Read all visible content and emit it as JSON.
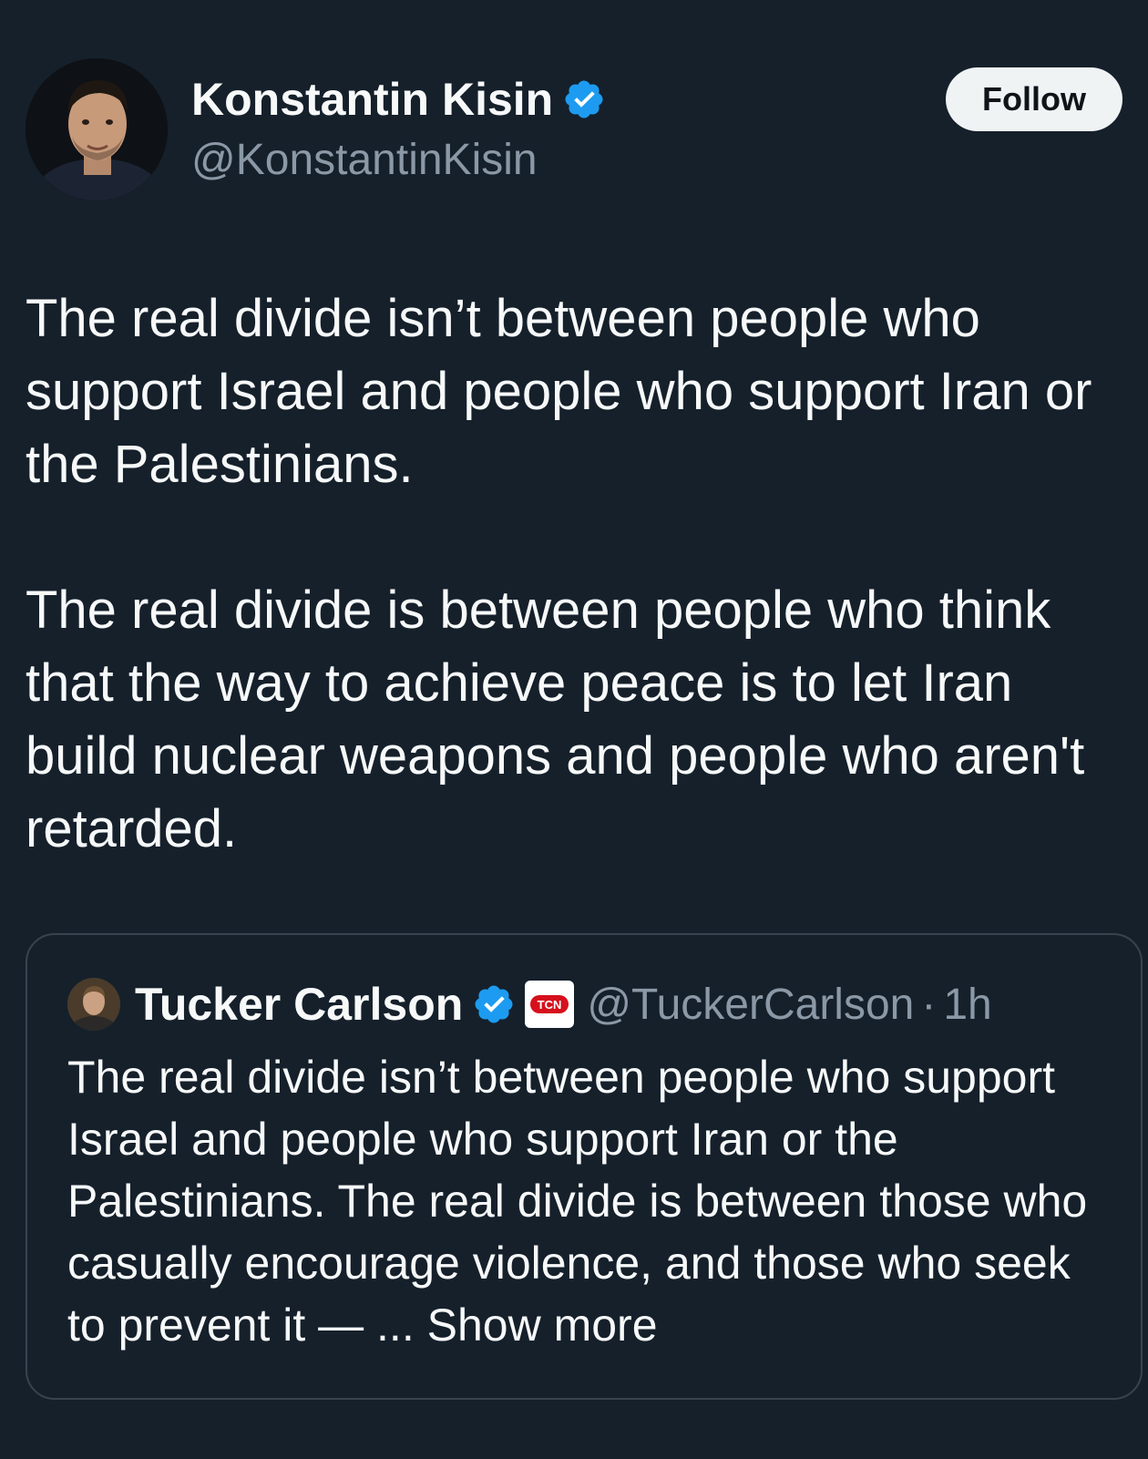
{
  "author": {
    "name": "Konstantin Kisin",
    "handle": "@KonstantinKisin",
    "verified": true
  },
  "follow_button": {
    "label": "Follow"
  },
  "tweet": {
    "paragraphs": [
      "The real divide isn’t between people who support Israel and people who support Iran or the Palestinians.",
      "The real divide is between people who think that the way to achieve peace is to let Iran build nuclear weapons and people who aren't retarded."
    ]
  },
  "quoted_tweet": {
    "name": "Tucker Carlson",
    "handle": "@TuckerCarlson",
    "separator": "·",
    "time": "1h",
    "affiliate_badge": "TCN",
    "text": "The real divide isn’t between people who support Israel and people who support Iran or the Palestinians. The real divide is between those who casually encourage violence, and those who seek to prevent it — ...",
    "show_more_label": "Show more"
  },
  "colors": {
    "background": "#15202b",
    "text": "#f7f9f9",
    "secondary_text": "#8b98a5",
    "verified_badge": "#1d9bf0",
    "border": "#38444d",
    "follow_button_bg": "#eff3f4",
    "affiliate_red": "#d6101d"
  },
  "icons": {
    "verified": "verified-badge-icon",
    "affiliate": "tcn-logo-icon"
  }
}
